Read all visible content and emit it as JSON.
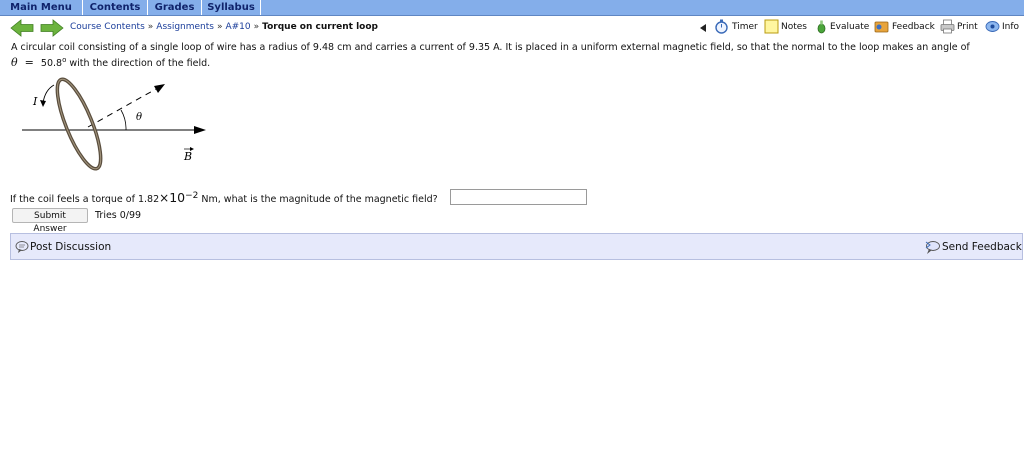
{
  "top_menu": [
    "Main Menu",
    "Contents",
    "Grades",
    "Syllabus"
  ],
  "breadcrumb": {
    "items": [
      "Course Contents",
      "Assignments",
      "A#10"
    ],
    "separator": "»",
    "current": "Torque on current loop"
  },
  "toolbar": {
    "timer": "Timer",
    "notes": "Notes",
    "evaluate": "Evaluate",
    "feedback": "Feedback",
    "print": "Print",
    "info": "Info"
  },
  "problem": {
    "line1": "A circular coil consisting of a single loop of wire has a radius of 9.48 cm and carries a current of 9.35 A. It is placed in a uniform external magnetic field, so that the normal to the loop makes an angle of",
    "theta_symbol": "θ",
    "equals": "=",
    "theta_value": "50.8",
    "degree": "o",
    "line2_rest": "with the direction of the field."
  },
  "figure": {
    "current_label": "I",
    "angle_label": "θ",
    "field_label": "B"
  },
  "question": {
    "prefix": "If the coil feels a torque of 1.82",
    "times": "×",
    "base": "10",
    "exponent": "−2",
    "suffix": "Nm, what is the magnitude of the magnetic field?"
  },
  "answer": {
    "value": ""
  },
  "submit_label": "Submit Answer",
  "tries": "Tries 0/99",
  "discussion": {
    "post": "Post Discussion",
    "send_feedback": "Send Feedback"
  },
  "colors": {
    "menu_bg": "#84aeea",
    "menu_text": "#10236b",
    "link": "#1a3d9a",
    "nav_arrow": "#6cb33e",
    "discussion_bg": "#e6e9fb"
  }
}
